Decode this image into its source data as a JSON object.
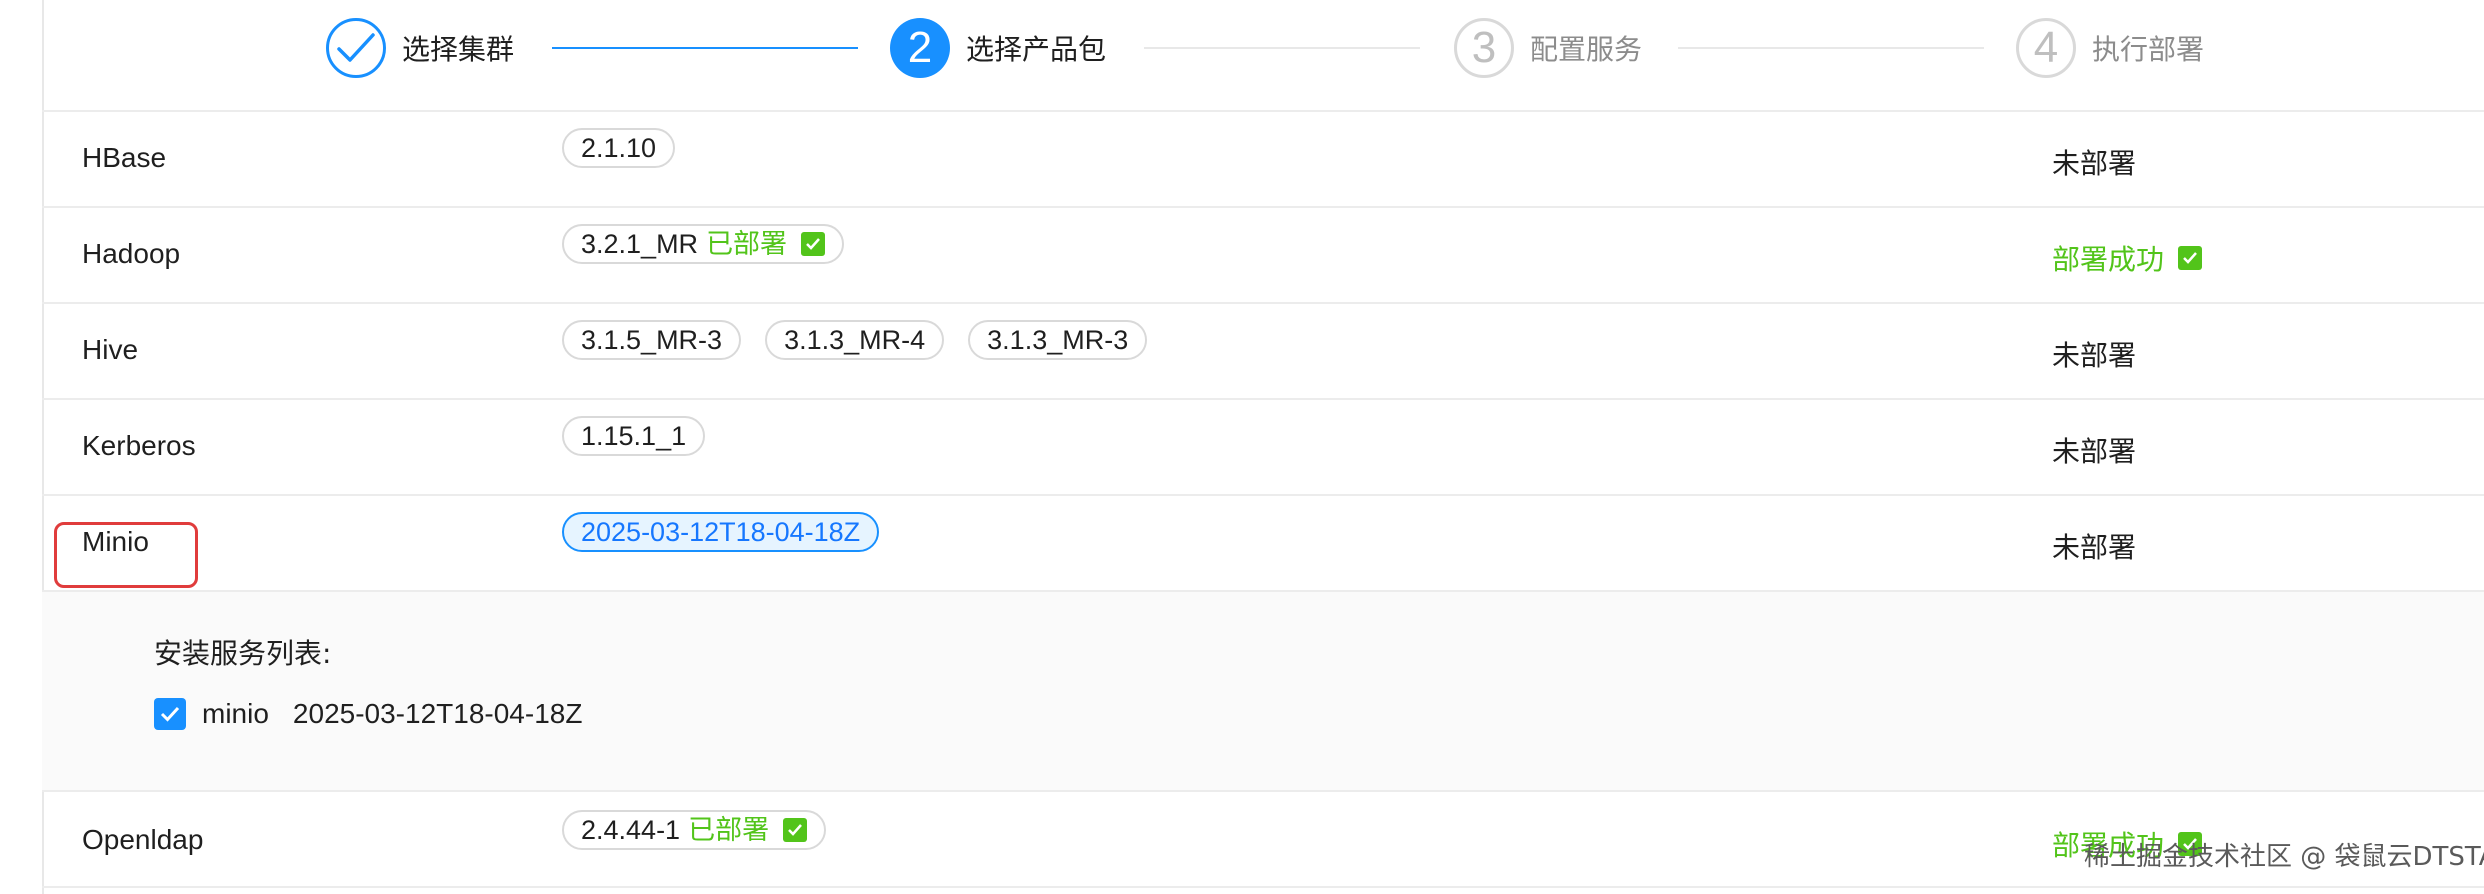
{
  "steps": [
    {
      "label": "选择集群",
      "state": "done"
    },
    {
      "number": "2",
      "label": "选择产品包",
      "state": "active"
    },
    {
      "number": "3",
      "label": "配置服务",
      "state": "wait"
    },
    {
      "number": "4",
      "label": "执行部署",
      "state": "wait"
    }
  ],
  "rows": [
    {
      "name": "HBase",
      "tags": [
        "2.1.10"
      ],
      "status": "未部署"
    },
    {
      "name": "Hadoop",
      "tags": [
        "3.2.1_MR"
      ],
      "tag_deployed": "已部署",
      "status": "部署成功"
    },
    {
      "name": "Hive",
      "tags": [
        "3.1.5_MR-3",
        "3.1.3_MR-4",
        "3.1.3_MR-3"
      ],
      "status": "未部署"
    },
    {
      "name": "Kerberos",
      "tags": [
        "1.15.1_1"
      ],
      "status": "未部署"
    },
    {
      "name": "Minio",
      "tags": [
        "2025-03-12T18-04-18Z"
      ],
      "status": "未部署"
    },
    {
      "name": "Openldap",
      "tags": [
        "2.4.44-1"
      ],
      "tag_deployed": "已部署",
      "status": "部署成功"
    }
  ],
  "expanded": {
    "title": "安装服务列表:",
    "service_name": "minio",
    "service_version": "2025-03-12T18-04-18Z"
  },
  "watermark": "稀土掘金技术社区 @ 袋鼠云DTSTACK",
  "colors": {
    "primary": "#1890ff",
    "success": "#52c41a",
    "highlight": "#e03c3c"
  }
}
